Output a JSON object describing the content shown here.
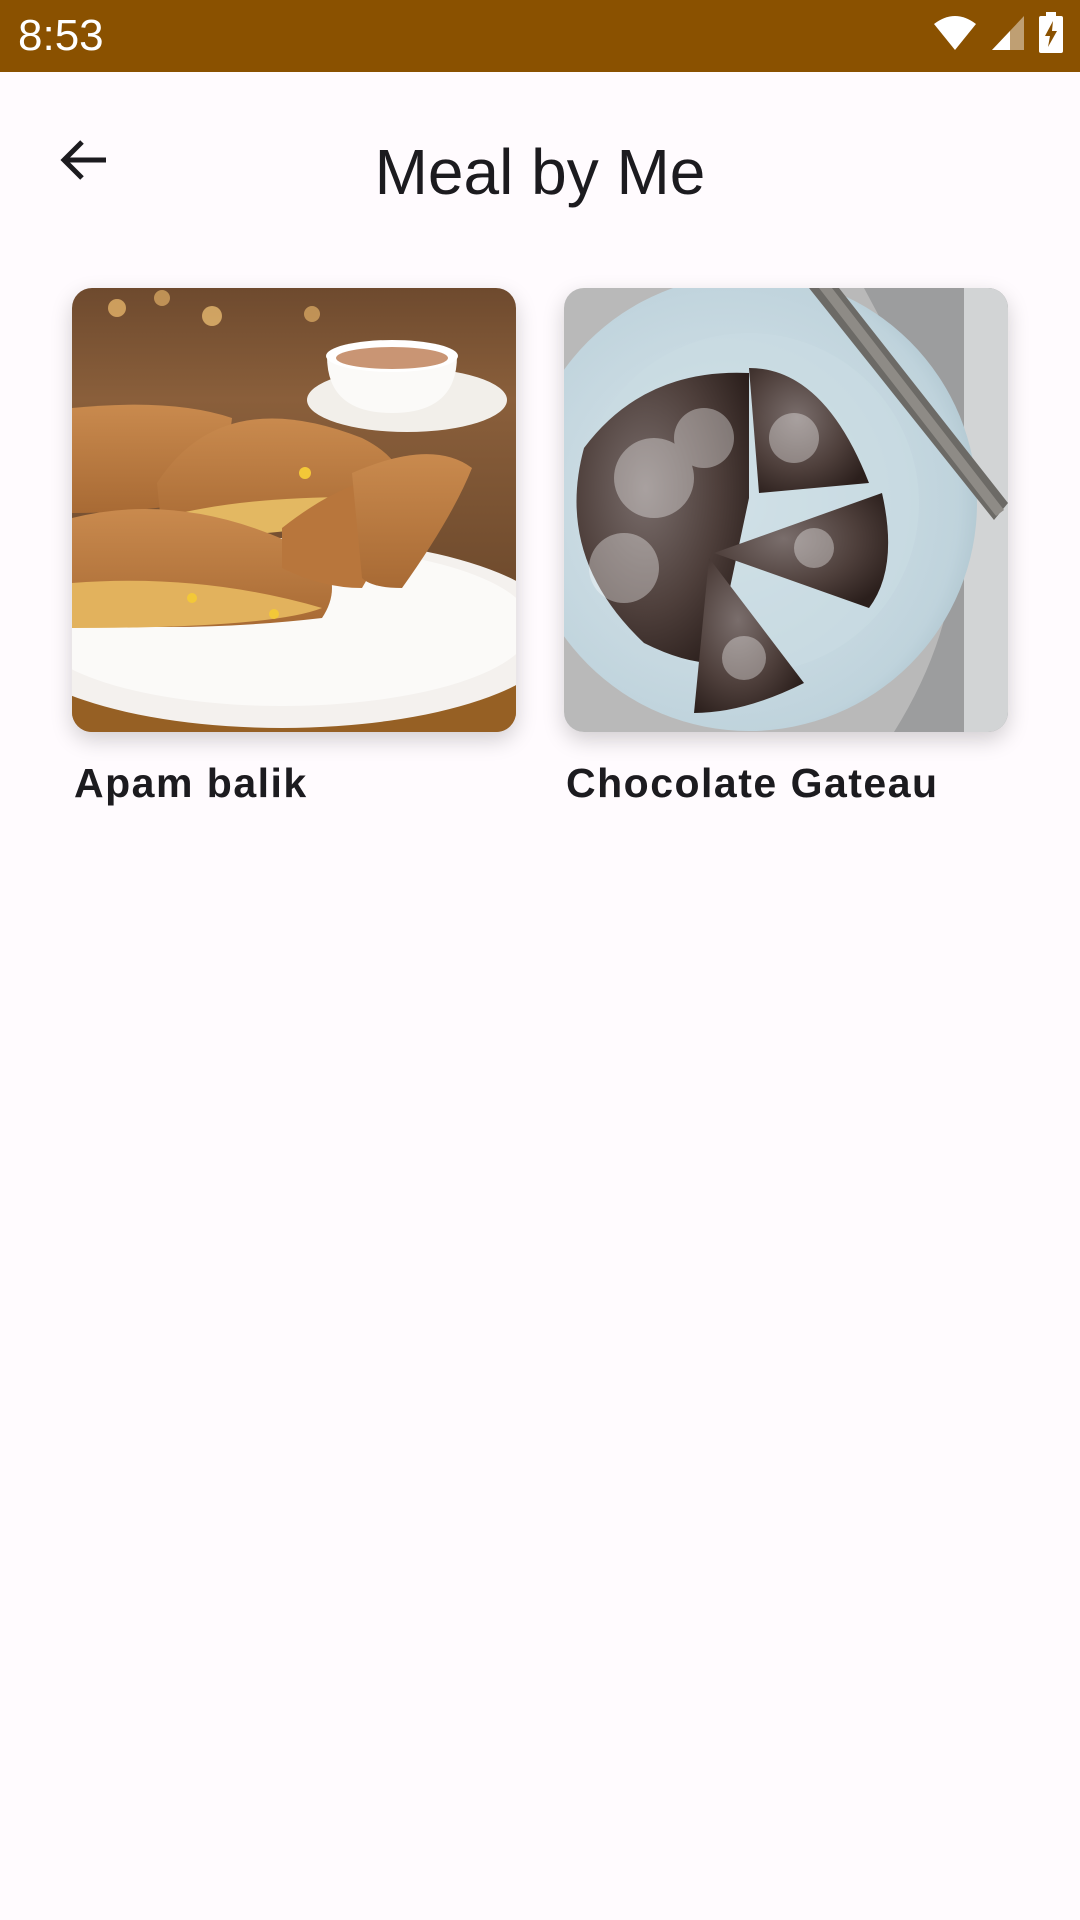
{
  "status_bar": {
    "time": "8:53",
    "icons": [
      "wifi-icon",
      "signal-icon",
      "battery-charging-icon"
    ],
    "background": "#8A5100"
  },
  "app_bar": {
    "title": "Meal by Me",
    "back_icon": "arrow-back-icon"
  },
  "meals": [
    {
      "name": "Apam balik",
      "image": "apam-balik-photo"
    },
    {
      "name": "Chocolate Gateau",
      "image": "chocolate-gateau-photo"
    }
  ],
  "colors": {
    "background": "#FFFBFE",
    "text": "#1C1B1F",
    "status_bar": "#8A5100"
  }
}
